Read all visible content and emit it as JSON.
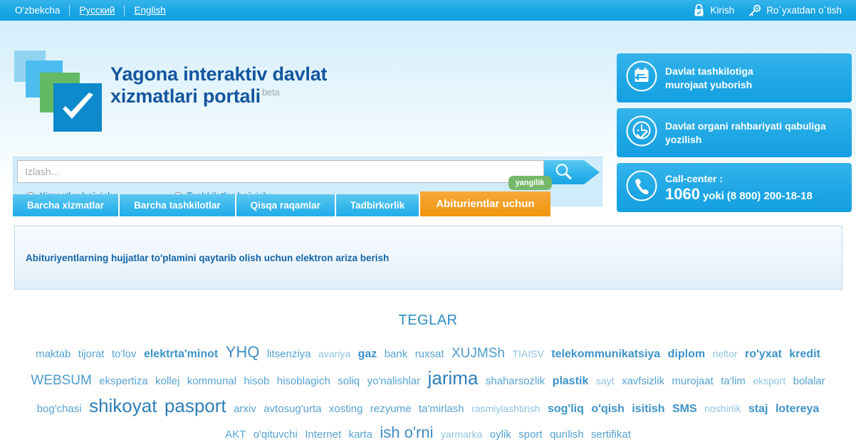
{
  "topbar": {
    "languages": [
      {
        "label": "O'zbekcha",
        "active": true
      },
      {
        "label": "Русский",
        "active": false
      },
      {
        "label": "English",
        "active": false
      }
    ],
    "login_label": "Kirish",
    "login_icon": "lock-icon",
    "register_label": "Ro`yxatdan o`tish",
    "register_icon": "key-icon"
  },
  "brand": {
    "title_line1": "Yagona interaktiv davlat",
    "title_line2": "xizmatlari portali",
    "beta": "beta",
    "logo_icon": "checkmark-squares-logo"
  },
  "search": {
    "placeholder": "Izlash...",
    "value": "",
    "button_icon": "search-icon",
    "options": [
      {
        "label": "Xizmatlar bo`yicha",
        "selected": false
      },
      {
        "label": "Tashkilotlar bo`yicha",
        "selected": false
      }
    ]
  },
  "panels": [
    {
      "icon": "mail-envelope-icon",
      "line1": "Davlat tashkilotiga",
      "line2": "murojaat yuborish"
    },
    {
      "icon": "clock-check-icon",
      "line1": "Davlat organi rahbariyati qabuliga",
      "line2": "yozilish"
    }
  ],
  "callcenter": {
    "icon": "phone-icon",
    "label": "Call-center :",
    "number": "1060",
    "conjunction": "yoki",
    "alt_number": "(8 800) 200-18-18"
  },
  "tabs": [
    {
      "label": "Barcha xizmatlar",
      "active": false
    },
    {
      "label": "Barcha tashkilotlar",
      "active": false
    },
    {
      "label": "Qisqa raqamlar",
      "active": false
    },
    {
      "label": "Tadbirkorlik",
      "active": false
    },
    {
      "label": "Abiturientlar uchun",
      "active": true,
      "badge": "yangilik"
    }
  ],
  "content": {
    "link": "Abituriyentlarning hujjatlar to'plamini qaytarib olish uchun elektron ariza berish"
  },
  "tags_section": {
    "title": "TEGLAR",
    "tags": [
      {
        "label": "maktab",
        "size": "s2"
      },
      {
        "label": "tijorat",
        "size": "s2"
      },
      {
        "label": "to'lov",
        "size": "s2"
      },
      {
        "label": "elektrta'minot",
        "size": "s3"
      },
      {
        "label": "YHQ",
        "size": "s5"
      },
      {
        "label": "litsenziya",
        "size": "s2"
      },
      {
        "label": "avariya",
        "size": "s1"
      },
      {
        "label": "gaz",
        "size": "s3"
      },
      {
        "label": "bank",
        "size": "s2"
      },
      {
        "label": "ruxsat",
        "size": "s2"
      },
      {
        "label": "XUJMSh",
        "size": "s4"
      },
      {
        "label": "TIAISV",
        "size": "s1"
      },
      {
        "label": "telekommunikatsiya",
        "size": "s3"
      },
      {
        "label": "diplom",
        "size": "s3"
      },
      {
        "label": "rieltor",
        "size": "s1"
      },
      {
        "label": "ro'yxat",
        "size": "s3"
      },
      {
        "label": "kredit",
        "size": "s3"
      },
      {
        "label": "WEBSUM",
        "size": "s4"
      },
      {
        "label": "ekspertiza",
        "size": "s2"
      },
      {
        "label": "kollej",
        "size": "s2"
      },
      {
        "label": "kommunal",
        "size": "s2"
      },
      {
        "label": "hisob",
        "size": "s2"
      },
      {
        "label": "hisoblagich",
        "size": "s2"
      },
      {
        "label": "soliq",
        "size": "s2"
      },
      {
        "label": "yo'nalishlar",
        "size": "s2"
      },
      {
        "label": "jarima",
        "size": "s6"
      },
      {
        "label": "shaharsozlik",
        "size": "s2"
      },
      {
        "label": "plastik",
        "size": "s3"
      },
      {
        "label": "sayt",
        "size": "s1"
      },
      {
        "label": "xavfsizlik",
        "size": "s2"
      },
      {
        "label": "murojaat",
        "size": "s2"
      },
      {
        "label": "ta'lim",
        "size": "s2"
      },
      {
        "label": "eksport",
        "size": "s1"
      },
      {
        "label": "bolalar",
        "size": "s2"
      },
      {
        "label": "bog'chasi",
        "size": "s2"
      },
      {
        "label": "shikoyat",
        "size": "s6"
      },
      {
        "label": "pasport",
        "size": "s6"
      },
      {
        "label": "arxiv",
        "size": "s2"
      },
      {
        "label": "avtosug'urta",
        "size": "s2"
      },
      {
        "label": "xosting",
        "size": "s2"
      },
      {
        "label": "rezyume",
        "size": "s2"
      },
      {
        "label": "ta'mirlash",
        "size": "s2"
      },
      {
        "label": "rasmiylashtirish",
        "size": "s1"
      },
      {
        "label": "sog'liq",
        "size": "s3"
      },
      {
        "label": "o'qish",
        "size": "s3"
      },
      {
        "label": "isitish",
        "size": "s3"
      },
      {
        "label": "SMS",
        "size": "s3"
      },
      {
        "label": "noshirlik",
        "size": "s1"
      },
      {
        "label": "staj",
        "size": "s3"
      },
      {
        "label": "lotereya",
        "size": "s3"
      },
      {
        "label": "AKT",
        "size": "s2"
      },
      {
        "label": "o'qituvchi",
        "size": "s2"
      },
      {
        "label": "Internet",
        "size": "s2"
      },
      {
        "label": "karta",
        "size": "s2"
      },
      {
        "label": "ish o'rni",
        "size": "s5"
      },
      {
        "label": "yarmarka",
        "size": "s1"
      },
      {
        "label": "oylik",
        "size": "s2"
      },
      {
        "label": "sport",
        "size": "s2"
      },
      {
        "label": "qurilish",
        "size": "s2"
      },
      {
        "label": "sertifikat",
        "size": "s2"
      }
    ]
  },
  "colors": {
    "brand_blue": "#14569e",
    "accent_blue": "#1ba6e4",
    "active_tab_orange": "#f39c1f",
    "badge_green": "#76b86a",
    "logo_green": "#64b964"
  }
}
